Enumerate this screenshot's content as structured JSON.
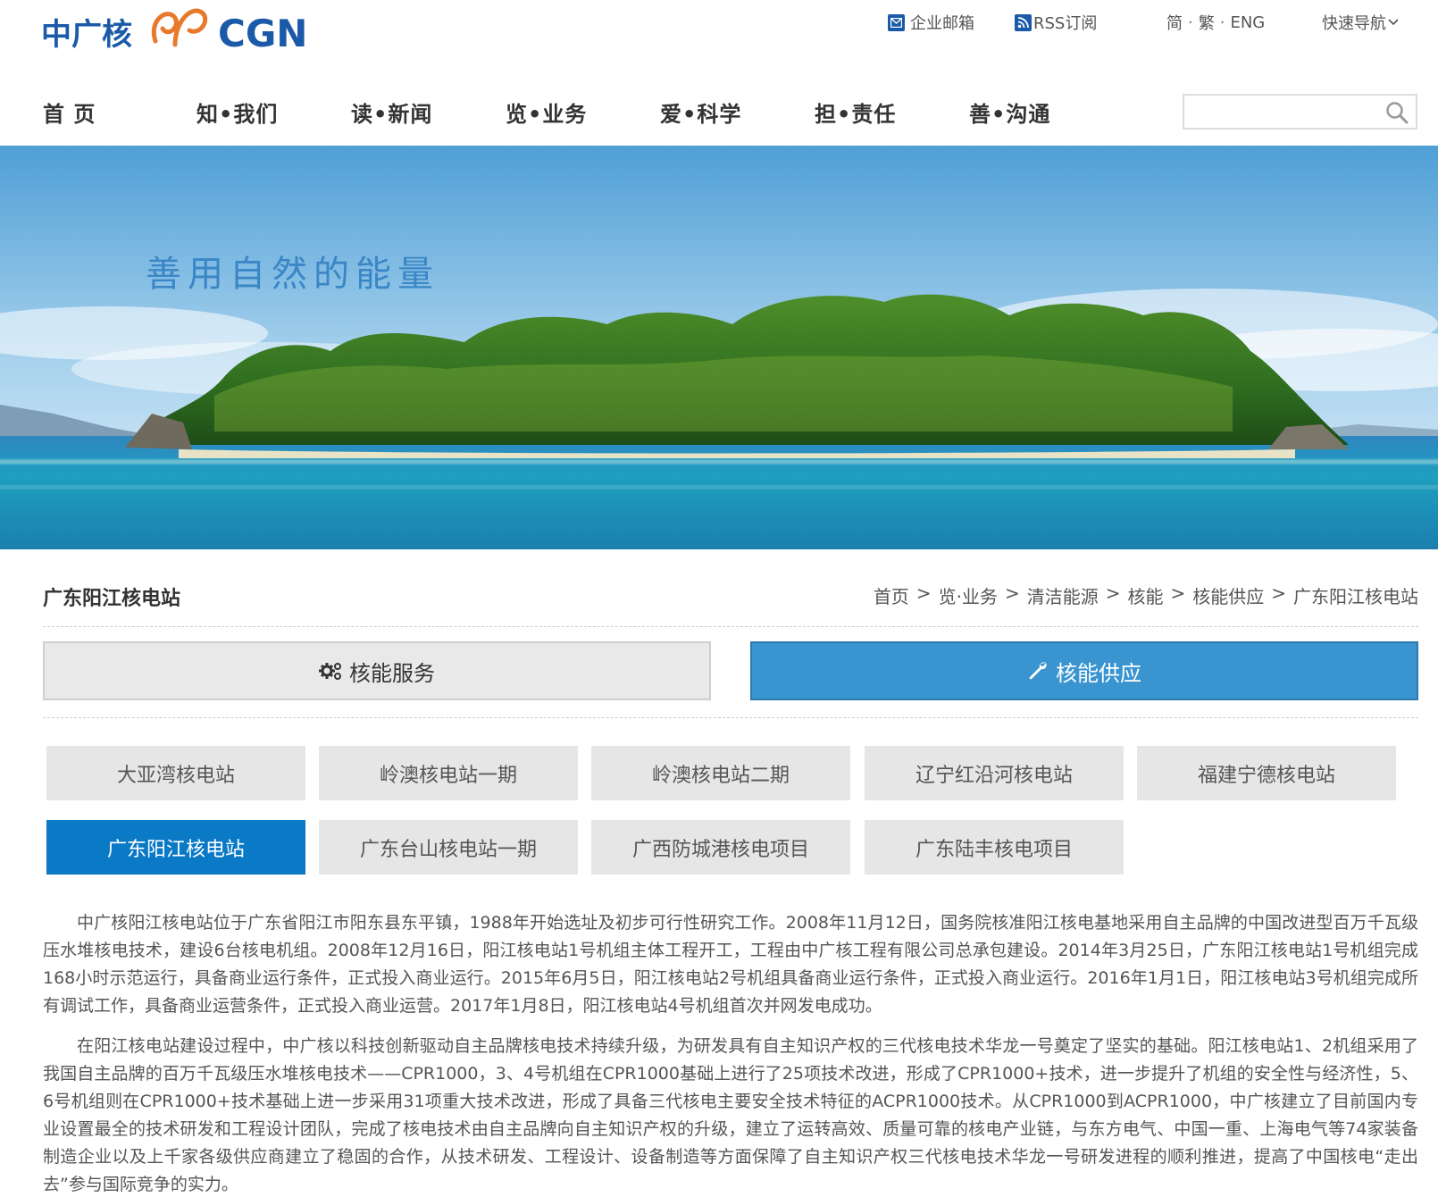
{
  "header": {
    "logo_alt": "中广核 CGN",
    "mail_label": "企业邮箱",
    "rss_label": "RSS订阅",
    "lang": [
      "简",
      "繁",
      "ENG"
    ],
    "quick_nav": "快速导航"
  },
  "nav": {
    "items": [
      {
        "label": "首 页"
      },
      {
        "label": "知•我们"
      },
      {
        "label": "读•新闻"
      },
      {
        "label": "览•业务"
      },
      {
        "label": "爱•科学"
      },
      {
        "label": "担•责任"
      },
      {
        "label": "善•沟通"
      }
    ],
    "search_placeholder": ""
  },
  "banner": {
    "slogan": "善用自然的能量"
  },
  "page": {
    "title": "广东阳江核电站",
    "breadcrumb": [
      "首页",
      "览·业务",
      "清洁能源",
      "核能",
      "核能供应",
      "广东阳江核电站"
    ]
  },
  "tabs": {
    "service": "核能服务",
    "supply": "核能供应",
    "active": "supply"
  },
  "stations": [
    {
      "label": "大亚湾核电站",
      "active": false
    },
    {
      "label": "岭澳核电站一期",
      "active": false
    },
    {
      "label": "岭澳核电站二期",
      "active": false
    },
    {
      "label": "辽宁红沿河核电站",
      "active": false
    },
    {
      "label": "福建宁德核电站",
      "active": false
    },
    {
      "label": "广东阳江核电站",
      "active": true
    },
    {
      "label": "广东台山核电站一期",
      "active": false
    },
    {
      "label": "广西防城港核电项目",
      "active": false
    },
    {
      "label": "广东陆丰核电项目",
      "active": false
    }
  ],
  "article": {
    "paragraphs": [
      "中广核阳江核电站位于广东省阳江市阳东县东平镇，1988年开始选址及初步可行性研究工作。2008年11月12日，国务院核准阳江核电基地采用自主品牌的中国改进型百万千瓦级压水堆核电技术，建设6台核电机组。2008年12月16日，阳江核电站1号机组主体工程开工，工程由中广核工程有限公司总承包建设。2014年3月25日，广东阳江核电站1号机组完成168小时示范运行，具备商业运行条件，正式投入商业运行。2015年6月5日，阳江核电站2号机组具备商业运行条件，正式投入商业运行。2016年1月1日，阳江核电站3号机组完成所有调试工作，具备商业运营条件，正式投入商业运营。2017年1月8日，阳江核电站4号机组首次并网发电成功。",
      "在阳江核电站建设过程中，中广核以科技创新驱动自主品牌核电技术持续升级，为研发具有自主知识产权的三代核电技术华龙一号奠定了坚实的基础。阳江核电站1、2机组采用了我国自主品牌的百万千瓦级压水堆核电技术——CPR1000，3、4号机组在CPR1000基础上进行了25项技术改进，形成了CPR1000+技术，进一步提升了机组的安全性与经济性，5、6号机组则在CPR1000+技术基础上进一步采用31项重大技术改进，形成了具备三代核电主要安全技术特征的ACPR1000技术。从CPR1000到ACPR1000，中广核建立了目前国内专业设置最全的技术研发和工程设计团队，完成了核电技术由自主品牌向自主知识产权的升级，建立了运转高效、质量可靠的核电产业链，与东方电气、中国一重、上海电气等74家装备制造企业以及上千家各级供应商建立了稳固的合作，从技术研发、工程设计、设备制造等方面保障了自主知识产权三代核电技术华龙一号研发进程的顺利推进，提高了中国核电“走出去”参与国际竞争的实力。"
    ]
  },
  "colors": {
    "brand_blue": "#1a5aa8",
    "logo_orange": "#e8792a",
    "active_tab": "#3a94cf",
    "active_station": "#0a79c6"
  }
}
